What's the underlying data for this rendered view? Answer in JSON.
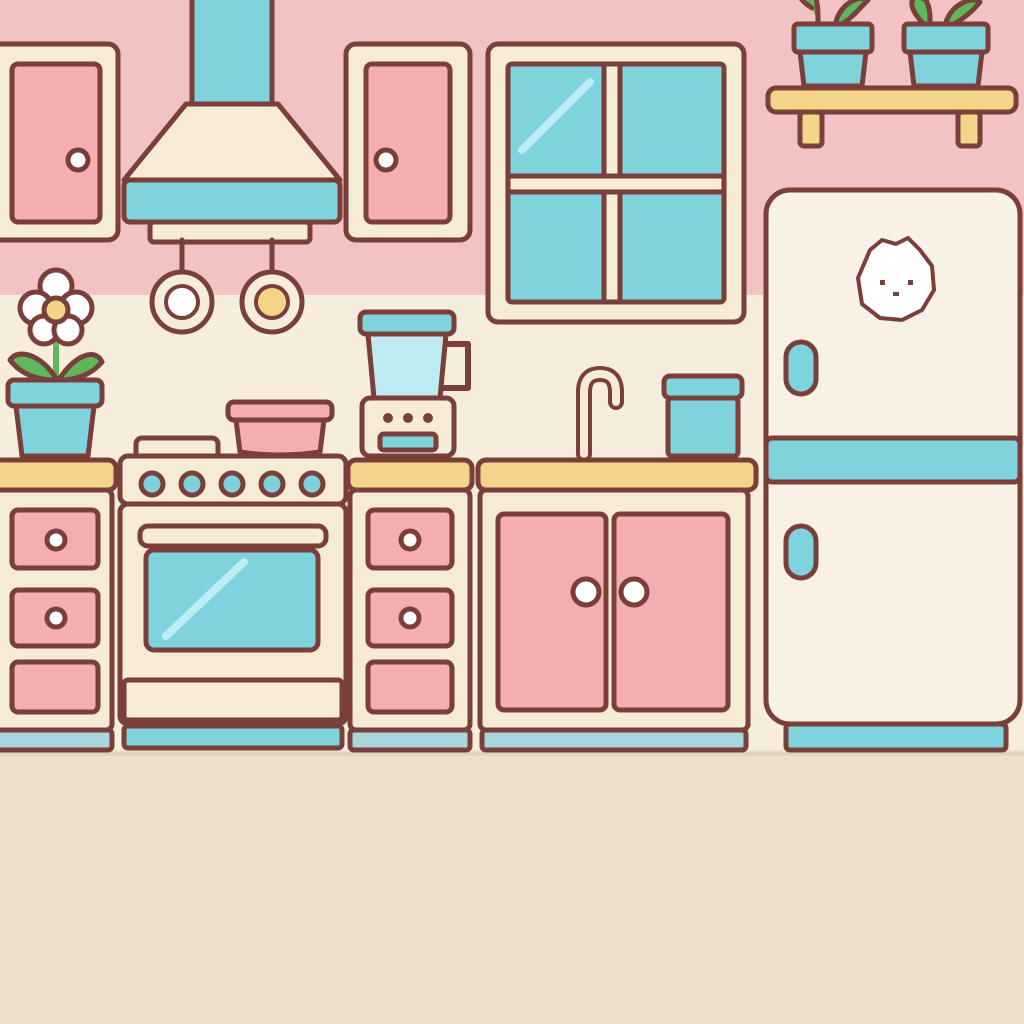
{
  "scene": {
    "kind": "kitchen-game-background",
    "objects": [
      "upper-cabinet-left",
      "range-hood",
      "hanging-pans",
      "upper-cabinet-right",
      "kitchen-window",
      "wall-shelf-with-plants",
      "flower-pot",
      "stove-with-oven",
      "cooking-pot",
      "blender",
      "sink-faucet",
      "canister",
      "drawer-cabinet-left",
      "drawer-cabinet-middle",
      "sink-cabinet-doors",
      "refrigerator",
      "fridge-magnet-face"
    ]
  },
  "colors": {
    "wall_upper": "#F2C2C4",
    "wall_lower": "#F6EDDC",
    "floor": "#EBE1CB",
    "outline": "#7A3F3A",
    "pink": "#F4AEB1",
    "blue": "#7FD3DC",
    "cream": "#F6EBD5",
    "wood": "#F4D489",
    "fridge": "#F7F1E6",
    "leaf": "#5DB85B"
  }
}
